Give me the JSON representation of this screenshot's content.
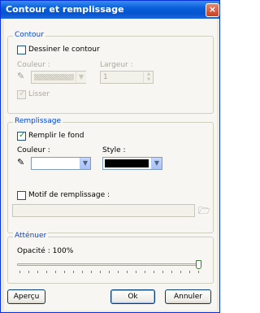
{
  "window": {
    "title": "Contour et remplissage",
    "close_glyph": "×"
  },
  "contour": {
    "legend": "Contour",
    "draw_label": "Dessiner le contour",
    "draw_checked": false,
    "color_label": "Couleur :",
    "width_label": "Largeur :",
    "width_value": "1",
    "smooth_label": "Lisser",
    "smooth_checked": true
  },
  "fill": {
    "legend": "Remplissage",
    "fill_label": "Remplir le fond",
    "fill_checked": true,
    "color_label": "Couleur :",
    "color_value": "#ffffff",
    "style_label": "Style :",
    "style_value": "#000000",
    "pattern_label": "Motif de remplissage :",
    "pattern_checked": false,
    "pattern_path": ""
  },
  "attenuate": {
    "legend": "Atténuer",
    "opacity_label": "Opacité : 100%",
    "opacity_fraction": 1.0
  },
  "buttons": {
    "preview": "Aperçu",
    "ok": "Ok",
    "cancel": "Annuler"
  },
  "icons": {
    "eyedropper": "eyedropper-icon",
    "folder": "folder-open-icon"
  }
}
